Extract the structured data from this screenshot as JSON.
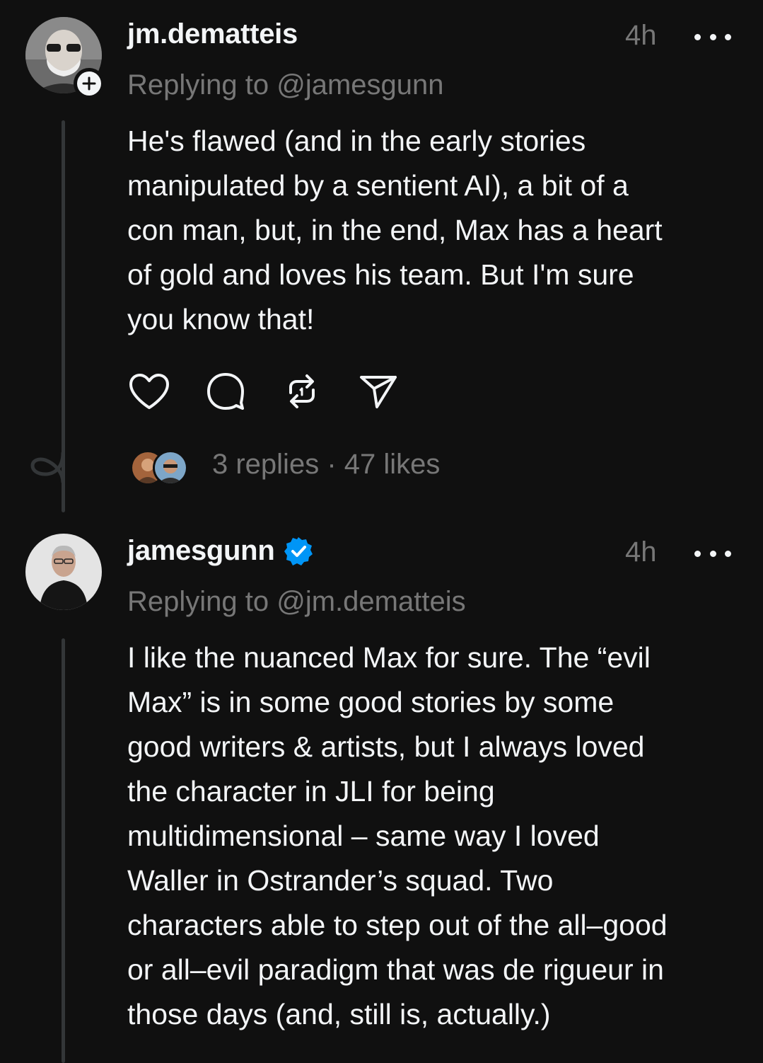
{
  "posts": [
    {
      "username": "jm.dematteis",
      "time": "4h",
      "reply_to": "Replying to @jamesgunn",
      "text": "He's flawed (and in the early stories\nmanipulated by a sentient AI), a bit of a\ncon man, but, in the end, Max has a heart\nof gold and loves his team.  But I'm sure\nyou know that!",
      "verified": false,
      "actions": [
        "heart-icon",
        "comment-icon",
        "repost-icon",
        "share-icon"
      ],
      "replies_count": "3 replies",
      "separator": "·",
      "likes_count": "47 likes"
    },
    {
      "username": "jamesgunn",
      "time": "4h",
      "reply_to": "Replying to @jm.dematteis",
      "text": "I like the nuanced Max for sure. The “evil\nMax” is in some good stories by some\ngood writers & artists, but I always loved\nthe character in JLI for being\nmultidimensional – same way I loved\nWaller in Ostrander’s squad. Two\ncharacters able to step out of the all–good\nor all–evil paradigm that was de rigueur in\nthose days (and, still is, actually.)",
      "verified": true
    }
  ],
  "colors": {
    "background": "#101010",
    "primary_text": "#f3f5f7",
    "secondary_text": "#777777",
    "verified_badge": "#0095f6",
    "thread_line": "#333638"
  }
}
